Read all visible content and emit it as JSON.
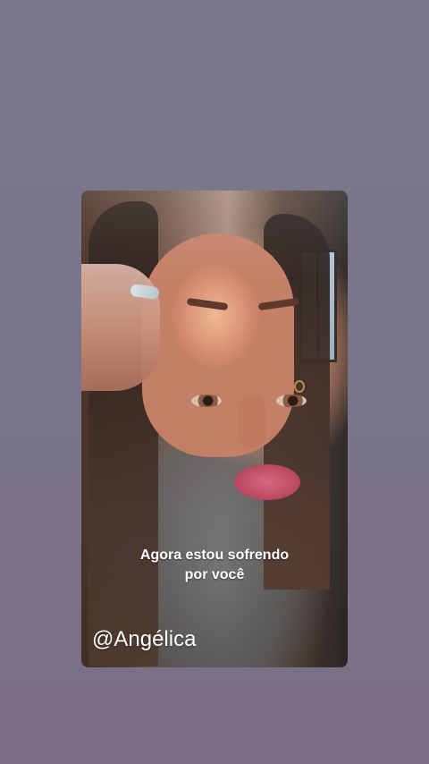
{
  "story": {
    "caption_line_1": "Agora estou sofrendo",
    "caption_line_2": "por você",
    "mention": "@Angélica"
  },
  "colors": {
    "background_top": "#7a7a8c",
    "background_bottom": "#7a6e86",
    "caption_text": "#ffffff",
    "mention_text": "#ffffff"
  }
}
